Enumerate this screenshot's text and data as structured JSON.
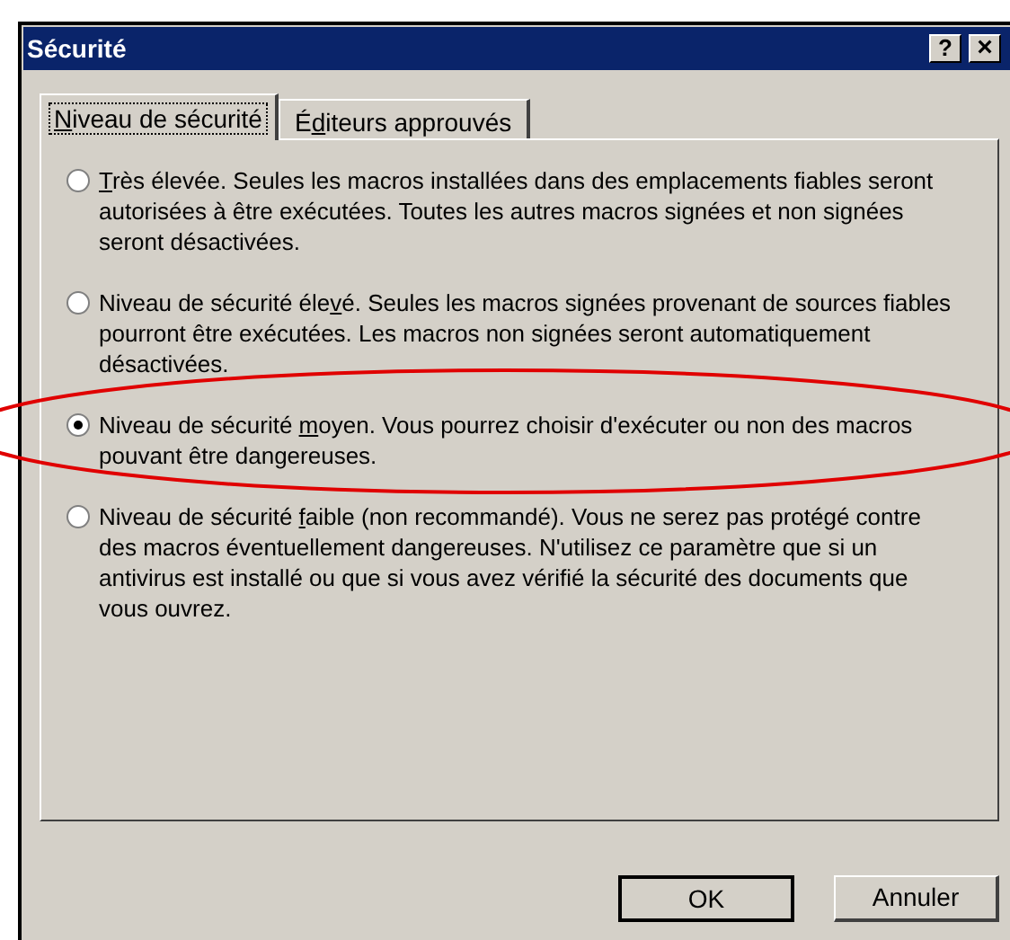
{
  "window": {
    "title": "Sécurité",
    "title_buttons": [
      {
        "kind": "help",
        "label": "?"
      },
      {
        "kind": "close",
        "label": "×"
      }
    ]
  },
  "tabs": [
    {
      "key": "N",
      "after": "iveau de sécurité",
      "selected": true
    },
    {
      "before": "É",
      "key": "d",
      "after": "iteurs approuvés",
      "selected": false
    }
  ],
  "options": [
    {
      "key": "T",
      "after": "rès élevée. Seules les macros installées dans des emplacements fiables seront autorisées à être exécutées. Toutes les autres macros signées et non signées seront désactivées.",
      "selected": false
    },
    {
      "before": "Niveau de sécurité éle",
      "key": "v",
      "after": "é. Seules les macros signées provenant de sources fiables pourront être exécutées. Les macros non signées seront automatiquement désactivées.",
      "selected": false
    },
    {
      "before": "Niveau de sécurité ",
      "key": "m",
      "after": "oyen. Vous pourrez choisir d'exécuter ou non des macros pouvant être dangereuses.",
      "selected": true
    },
    {
      "before": "Niveau de sécurité ",
      "key": "f",
      "after": "aible (non recommandé). Vous ne serez pas protégé contre des macros éventuellement dangereuses. N'utilisez ce paramètre que si un antivirus est installé ou que si vous avez vérifié la sécurité des documents que vous ouvrez.",
      "selected": false
    }
  ],
  "buttons": [
    {
      "label": "OK",
      "default": true
    },
    {
      "label": "Annuler",
      "default": false
    }
  ]
}
